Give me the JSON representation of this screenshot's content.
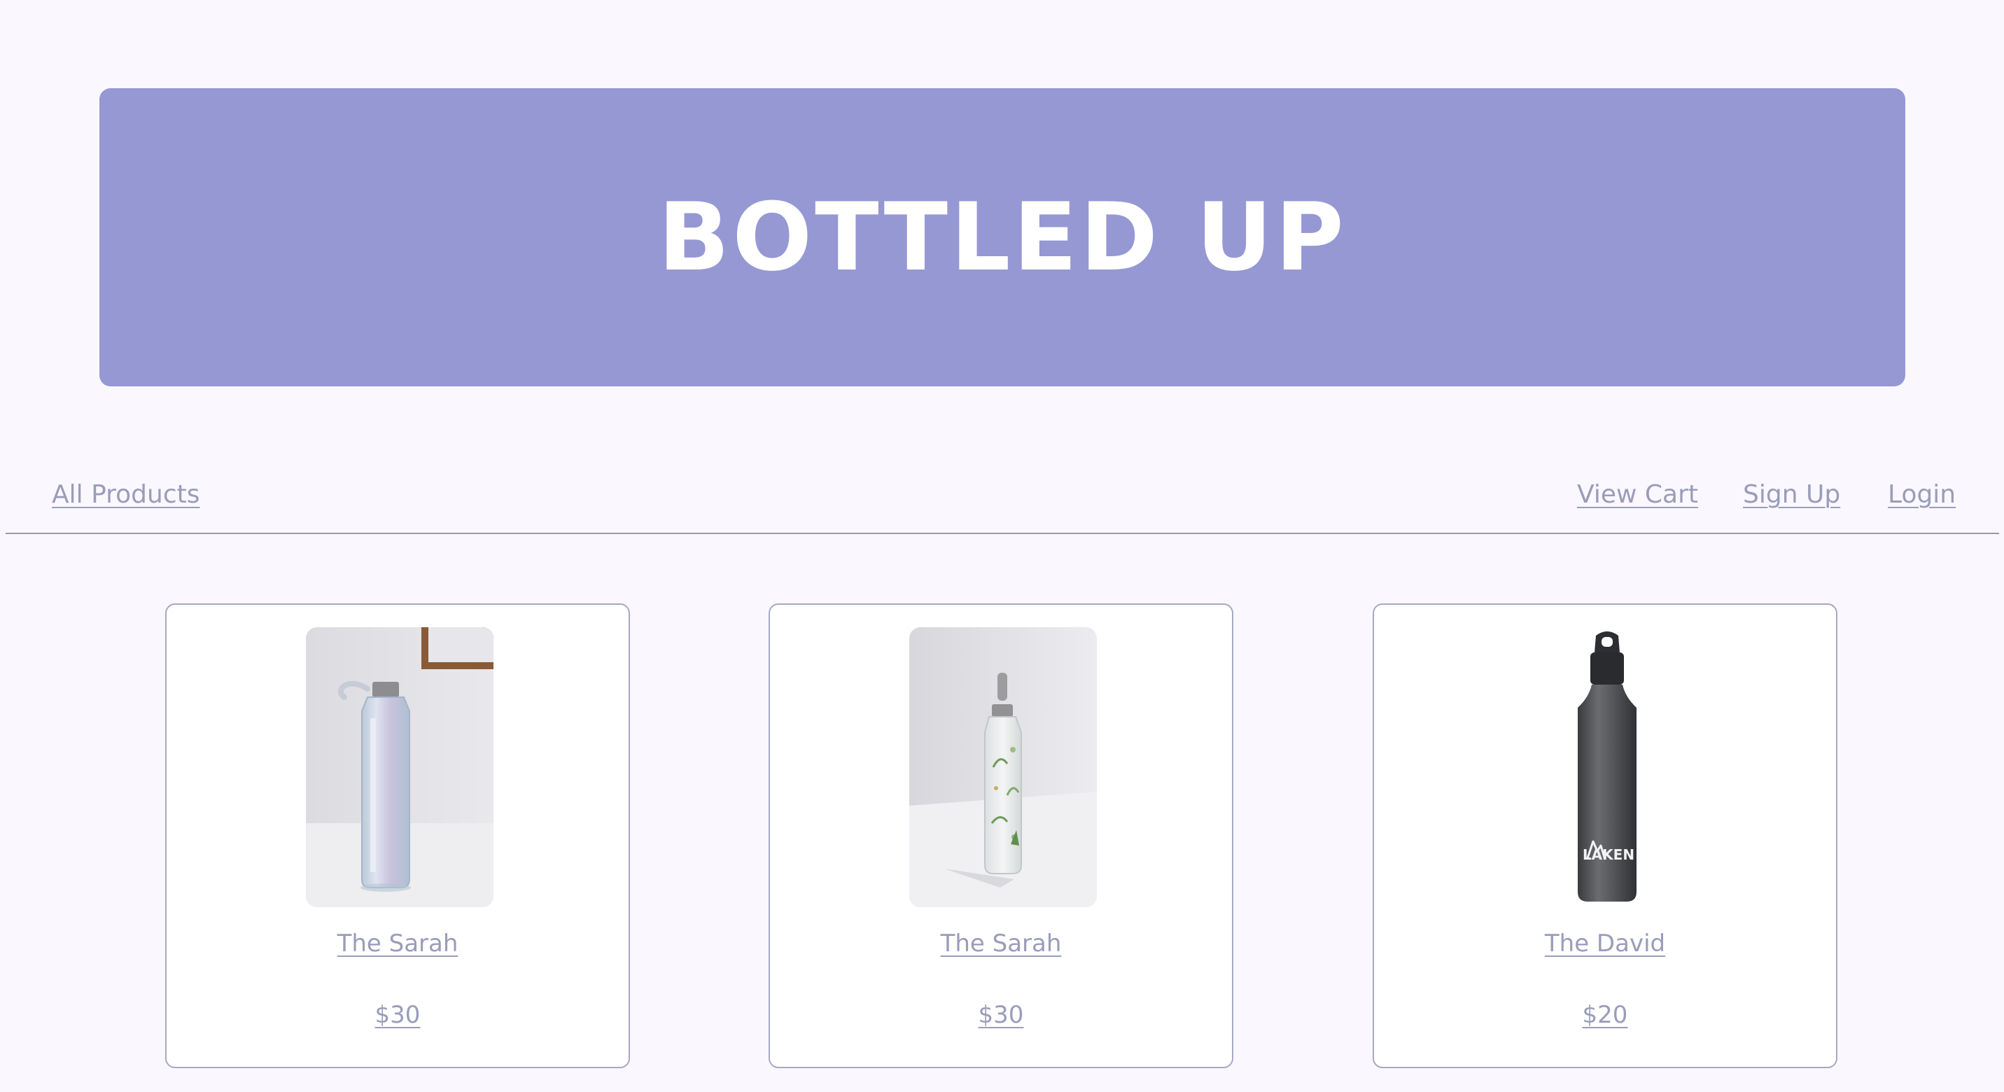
{
  "header": {
    "title": "BOTTLED UP",
    "banner_color": "#9598d3"
  },
  "nav": {
    "all_products": "All Products",
    "view_cart": "View Cart",
    "sign_up": "Sign Up",
    "login": "Login",
    "link_color": "#9a9db9"
  },
  "products": [
    {
      "name": "The Sarah",
      "price": "$30",
      "image": "clear-glass-bottle"
    },
    {
      "name": "The Sarah",
      "price": "$30",
      "image": "floral-glass-bottle"
    },
    {
      "name": "The David",
      "price": "$20",
      "image": "gray-aluminum-bottle",
      "brand": "LAKEN"
    }
  ]
}
